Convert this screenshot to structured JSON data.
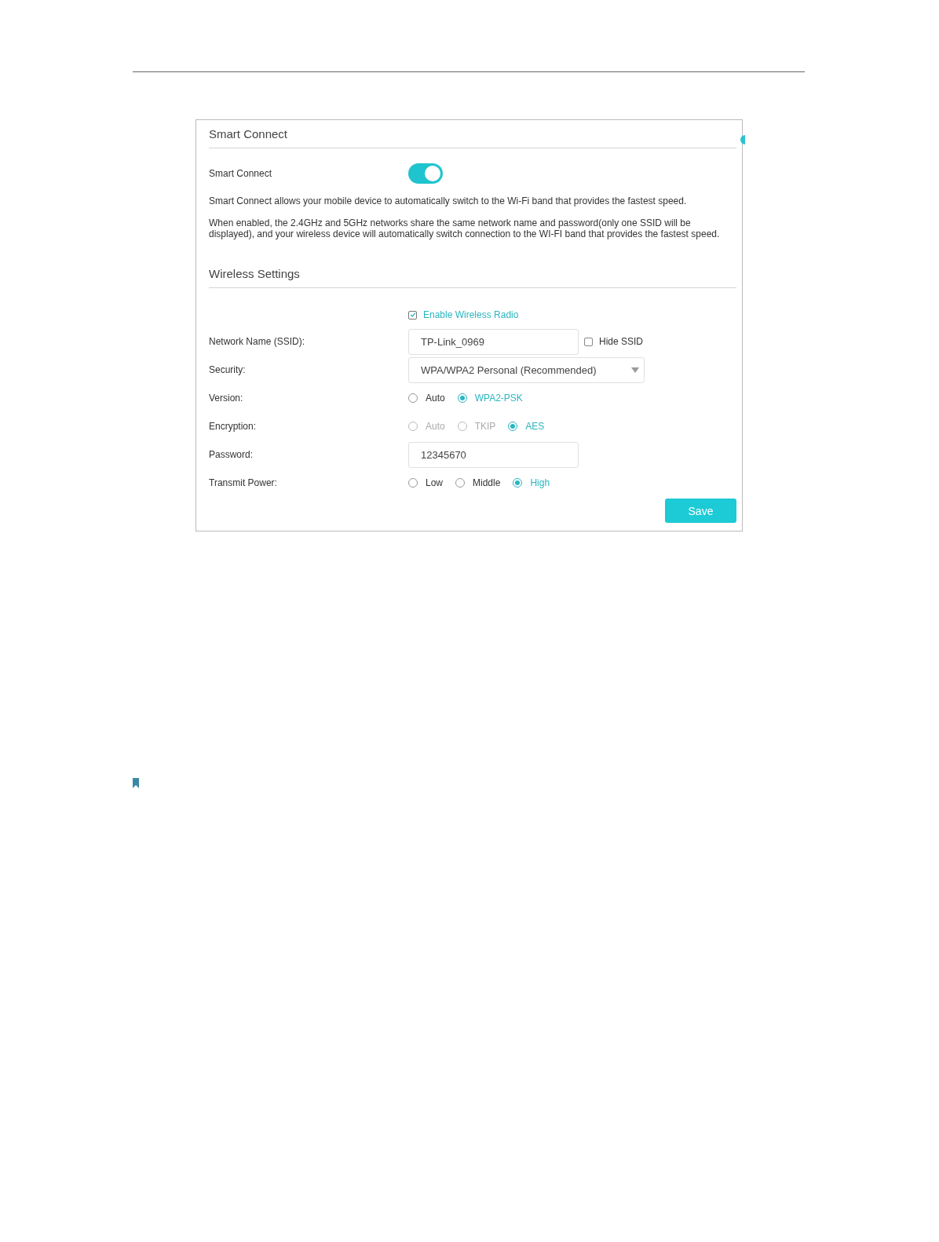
{
  "smart_connect": {
    "title": "Smart Connect",
    "label": "Smart Connect",
    "on": true,
    "descriptions": [
      "Smart Connect allows your mobile device to automatically switch to the Wi-Fi band that provides the fastest speed.",
      "When enabled, the 2.4GHz and 5GHz networks share the same network name and password(only one SSID will be displayed), and your wireless device will automatically switch connection to the WI-FI band that provides the fastest speed."
    ]
  },
  "wireless_settings": {
    "title": "Wireless Settings",
    "enable_radio": {
      "label": "Enable Wireless Radio",
      "checked": true
    },
    "rows": [
      {
        "kind": "text",
        "label": "Network Name (SSID):",
        "value": "TP-Link_0969",
        "option": {
          "label": "Hide SSID",
          "checked": false
        }
      },
      {
        "kind": "select",
        "label": "Security:",
        "value": "WPA/WPA2 Personal (Recommended)"
      },
      {
        "kind": "radio",
        "label": "Version:",
        "options": [
          {
            "label": "Auto",
            "selected": false,
            "disabled": false
          },
          {
            "label": "WPA2-PSK",
            "selected": true,
            "disabled": false
          }
        ]
      },
      {
        "kind": "radio",
        "label": "Encryption:",
        "options": [
          {
            "label": "Auto",
            "selected": false,
            "disabled": true
          },
          {
            "label": "TKIP",
            "selected": false,
            "disabled": true
          },
          {
            "label": "AES",
            "selected": true,
            "disabled": false
          }
        ]
      },
      {
        "kind": "text",
        "label": "Password:",
        "value": "12345670"
      },
      {
        "kind": "radio",
        "label": "Transmit Power:",
        "options": [
          {
            "label": "Low",
            "selected": false,
            "disabled": false
          },
          {
            "label": "Middle",
            "selected": false,
            "disabled": false
          },
          {
            "label": "High",
            "selected": true,
            "disabled": false
          }
        ]
      }
    ],
    "save_button": "Save"
  }
}
